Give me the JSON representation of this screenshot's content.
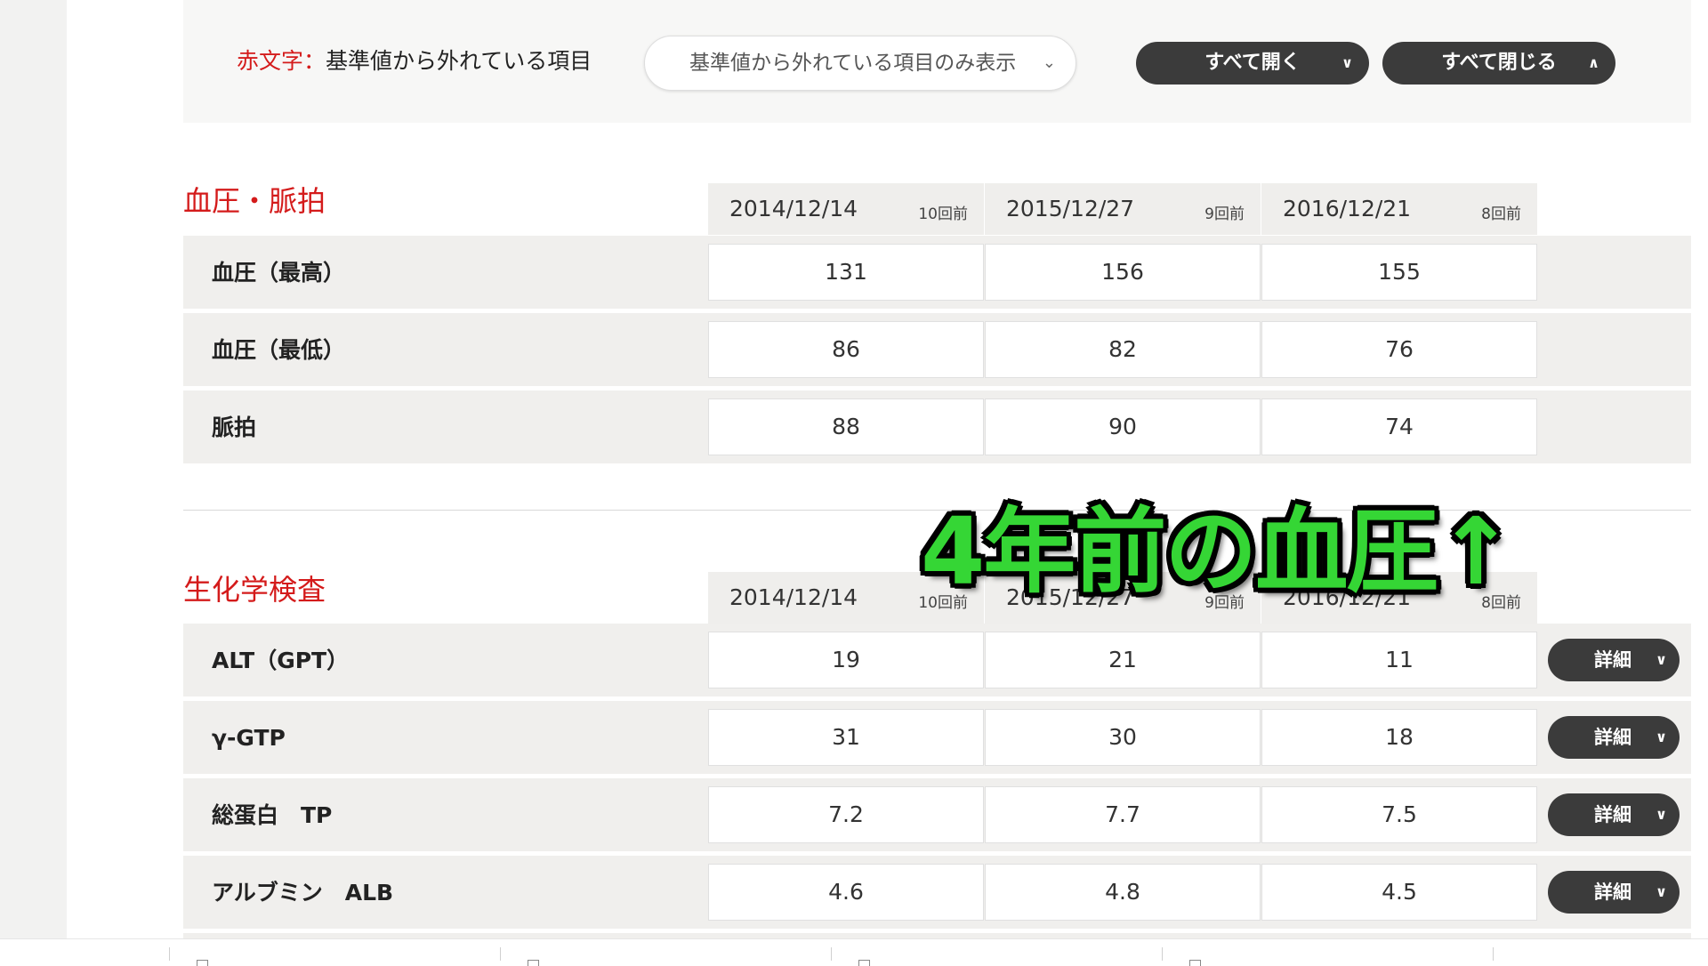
{
  "filter": {
    "legend_red": "赤文字：",
    "legend_text": "基準値から外れている項目",
    "select_value": "基準値から外れている項目のみ表示",
    "expand_all": "すべて開く",
    "collapse_all": "すべて閉じる"
  },
  "columns": [
    {
      "date": "2014/12/14",
      "ago": "10回前"
    },
    {
      "date": "2015/12/27",
      "ago": "9回前"
    },
    {
      "date": "2016/12/21",
      "ago": "8回前"
    }
  ],
  "sections": [
    {
      "title": "血圧・脈拍",
      "rows": [
        {
          "label": "血圧（最高）",
          "values": [
            "131",
            "156",
            "155"
          ]
        },
        {
          "label": "血圧（最低）",
          "values": [
            "86",
            "82",
            "76"
          ]
        },
        {
          "label": "脈拍",
          "values": [
            "88",
            "90",
            "74"
          ]
        }
      ]
    },
    {
      "title": "生化学検査",
      "detail_label": "詳細",
      "rows": [
        {
          "label": "ALT（GPT）",
          "values": [
            "19",
            "21",
            "11"
          ]
        },
        {
          "label": "γ-GTP",
          "values": [
            "31",
            "30",
            "18"
          ]
        },
        {
          "label": "総蛋白　TP",
          "values": [
            "7.2",
            "7.7",
            "7.5"
          ]
        },
        {
          "label": "アルブミン　ALB",
          "values": [
            "4.6",
            "4.8",
            "4.5"
          ]
        }
      ]
    }
  ],
  "overlay": {
    "caption": "4年前の血圧↑"
  },
  "colors": {
    "accent_red": "#d41b1b",
    "button_dark": "#3b3b3b",
    "overlay_green": "#35d635"
  },
  "icons": [
    "chevron-down-icon",
    "chevron-up-icon",
    "document-icon"
  ]
}
